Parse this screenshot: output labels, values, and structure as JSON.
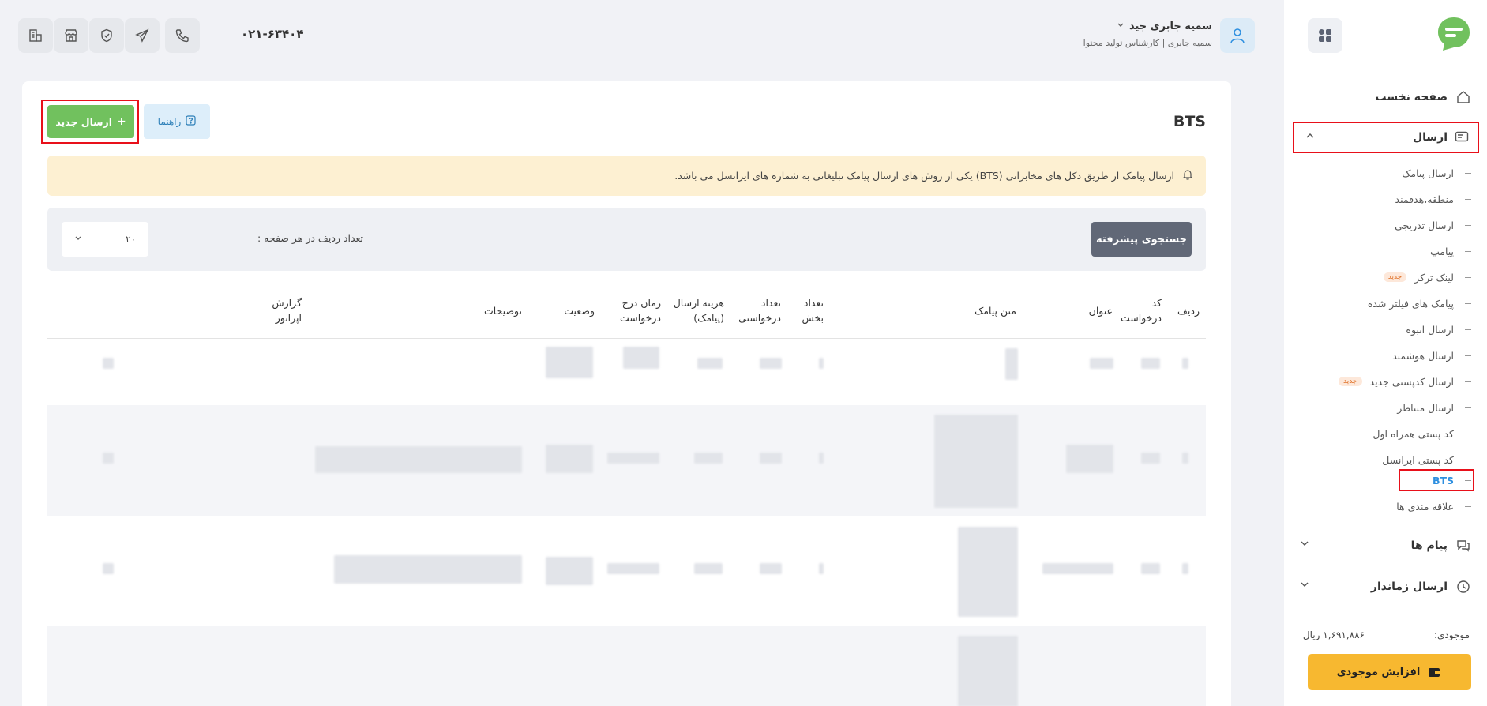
{
  "sidebar": {
    "home": "صفحه نخست",
    "send": "ارسال",
    "sub_items": [
      {
        "label": "ارسال پیامک",
        "badge": ""
      },
      {
        "label": "منطقه،هدفمند",
        "badge": ""
      },
      {
        "label": "ارسال تدریجی",
        "badge": ""
      },
      {
        "label": "پیامپ",
        "badge": ""
      },
      {
        "label": "لینک ترکر",
        "badge": "جدید"
      },
      {
        "label": "پیامک های فیلتر شده",
        "badge": ""
      },
      {
        "label": "ارسال انبوه",
        "badge": ""
      },
      {
        "label": "ارسال هوشمند",
        "badge": ""
      },
      {
        "label": "ارسال کدپستی جدید",
        "badge": "جدید"
      },
      {
        "label": "ارسال متناظر",
        "badge": ""
      },
      {
        "label": "کد پستی همراه اول",
        "badge": ""
      },
      {
        "label": "کد پستی ایرانسل",
        "badge": ""
      },
      {
        "label": "BTS",
        "badge": ""
      },
      {
        "label": "علاقه مندی ها",
        "badge": ""
      }
    ],
    "messages": "پیام ها",
    "scheduled": "ارسال زماندار",
    "balance_label": "موجودی:",
    "balance_value": "۱,۶۹۱,۸۸۶ ریال",
    "charge_button": "افزایش موجودی"
  },
  "header": {
    "user_name": "سمیه جابری جید",
    "user_role": "سمیه جابری | کارشناس تولید محتوا",
    "phone": "۰۲۱-۶۳۴۰۴"
  },
  "main": {
    "title": "BTS",
    "new_send": "ارسال جدید",
    "guide": "راهنما",
    "alert": "ارسال پیامک از طریق دکل های مخابراتی (BTS) یکی از روش های ارسال پیامک تبلیغاتی به شماره های ایرانسل می باشد.",
    "advanced_search": "جستجوی پیشرفته",
    "rows_per_page_label": "تعداد ردیف در هر صفحه :",
    "rows_per_page_value": "۲۰"
  },
  "table": {
    "columns": [
      "ردیف",
      "کد درخواست",
      "عنوان",
      "متن پیامک",
      "تعداد بخش",
      "تعداد درخواستی",
      "هزینه ارسال (پیامک)",
      "زمان درج درخواست",
      "وضعیت",
      "توضیحات",
      "گزارش اپراتور"
    ]
  },
  "colors": {
    "brand_green": "#71c15e",
    "highlight_red": "#e8101a",
    "active_blue": "#2d8fe0",
    "charge_yellow": "#f7b830",
    "alert_bg": "#fdf0d2"
  }
}
